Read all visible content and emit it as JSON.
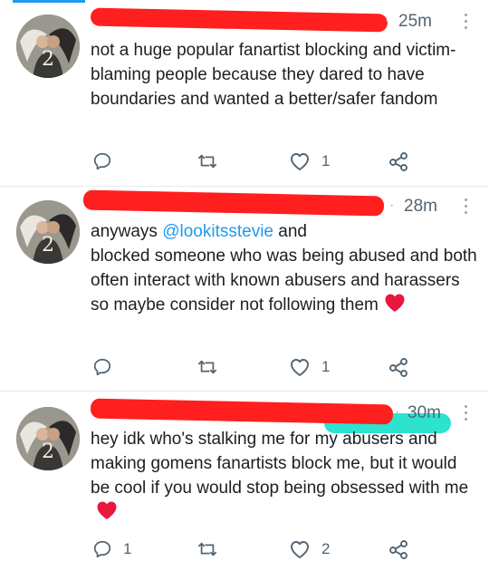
{
  "feed": {
    "tweets": [
      {
        "time": "25m",
        "text": "not a huge popular fanartist blocking and victim-blaming people because they dared to have boundaries and wanted a better/safer fandom",
        "reply_count": "",
        "like_count": "1"
      },
      {
        "time": "28m",
        "text_before": "anyways ",
        "mention": "@lookitsstevie",
        "text_mid": " and",
        "text_after": "blocked someone who was being abused and both often interact with known abusers and harassers so maybe consider not following them",
        "reply_count": "",
        "like_count": "1"
      },
      {
        "time": "30m",
        "name_fragment": "...​",
        "text": "hey idk who's stalking me for my abusers and making gomens fanartists block me, but it would be cool if you would stop being obsessed with me",
        "reply_count": "1",
        "like_count": "2"
      }
    ]
  },
  "icons": {
    "reply": "reply-icon",
    "retweet": "retweet-icon",
    "like": "like-icon",
    "share": "share-icon",
    "more": "more-icon"
  },
  "colors": {
    "accent": "#1d9bf0",
    "redaction_red": "#ff1f1f",
    "redaction_cyan": "#2de3d0",
    "icon_gray": "#536471",
    "emoji_heart": "#e8173f"
  }
}
